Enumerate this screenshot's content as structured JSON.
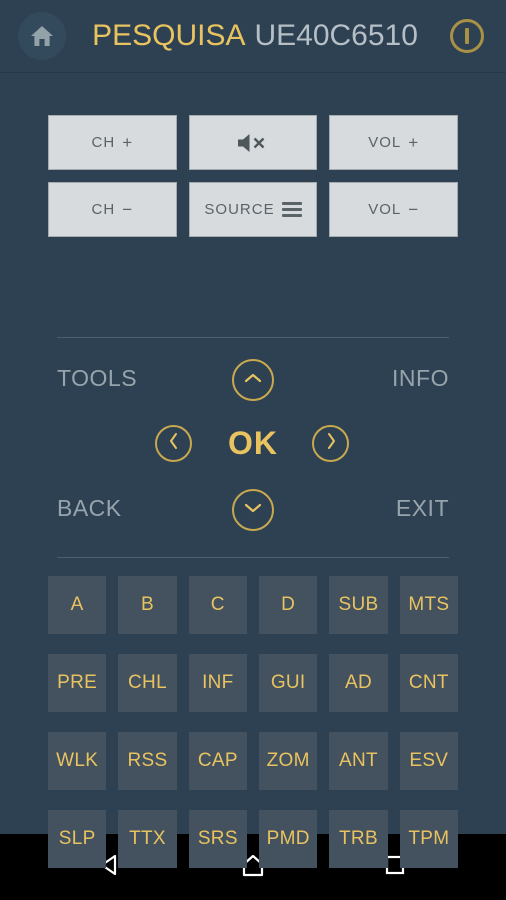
{
  "header": {
    "home_icon": "home-icon",
    "brand": "PESQUISA",
    "model": "UE40C6510",
    "power_icon": "power-icon"
  },
  "pad": {
    "rows": [
      [
        {
          "name": "ch-up",
          "label": "CH",
          "suffix": "+",
          "icon": null
        },
        {
          "name": "mute",
          "label": "",
          "suffix": "",
          "icon": "mute-speaker-icon"
        },
        {
          "name": "vol-up",
          "label": "VOL",
          "suffix": "+",
          "icon": null
        }
      ],
      [
        {
          "name": "ch-down",
          "label": "CH",
          "suffix": "−",
          "icon": null
        },
        {
          "name": "source",
          "label": "SOURCE",
          "suffix": "",
          "icon": "hamburger-icon"
        },
        {
          "name": "vol-down",
          "label": "VOL",
          "suffix": "−",
          "icon": null
        }
      ]
    ]
  },
  "nav": {
    "tools": "TOOLS",
    "info": "INFO",
    "back": "BACK",
    "exit": "EXIT",
    "ok": "OK",
    "up_icon": "chevron-up-icon",
    "down_icon": "chevron-down-icon",
    "left_icon": "chevron-left-icon",
    "right_icon": "chevron-right-icon"
  },
  "grid": {
    "keys": [
      "A",
      "B",
      "C",
      "D",
      "SUB",
      "MTS",
      "PRE",
      "CHL",
      "INF",
      "GUI",
      "AD",
      "CNT",
      "WLK",
      "RSS",
      "CAP",
      "ZOM",
      "ANT",
      "ESV",
      "SLP",
      "TTX",
      "SRS",
      "PMD",
      "TRB",
      "TPM"
    ]
  },
  "navbar": {
    "back_icon": "triangle-back-icon",
    "home_icon": "home-outline-icon",
    "recents_icon": "square-recents-icon"
  },
  "colors": {
    "background": "#2d4153",
    "accent_gold": "#e9c35f",
    "ring_gold": "#c9a94e",
    "key_tile": "#44525f",
    "pad_button": "#d7dbdd",
    "label_grey": "#98a4ac",
    "navbar": "#000000"
  }
}
